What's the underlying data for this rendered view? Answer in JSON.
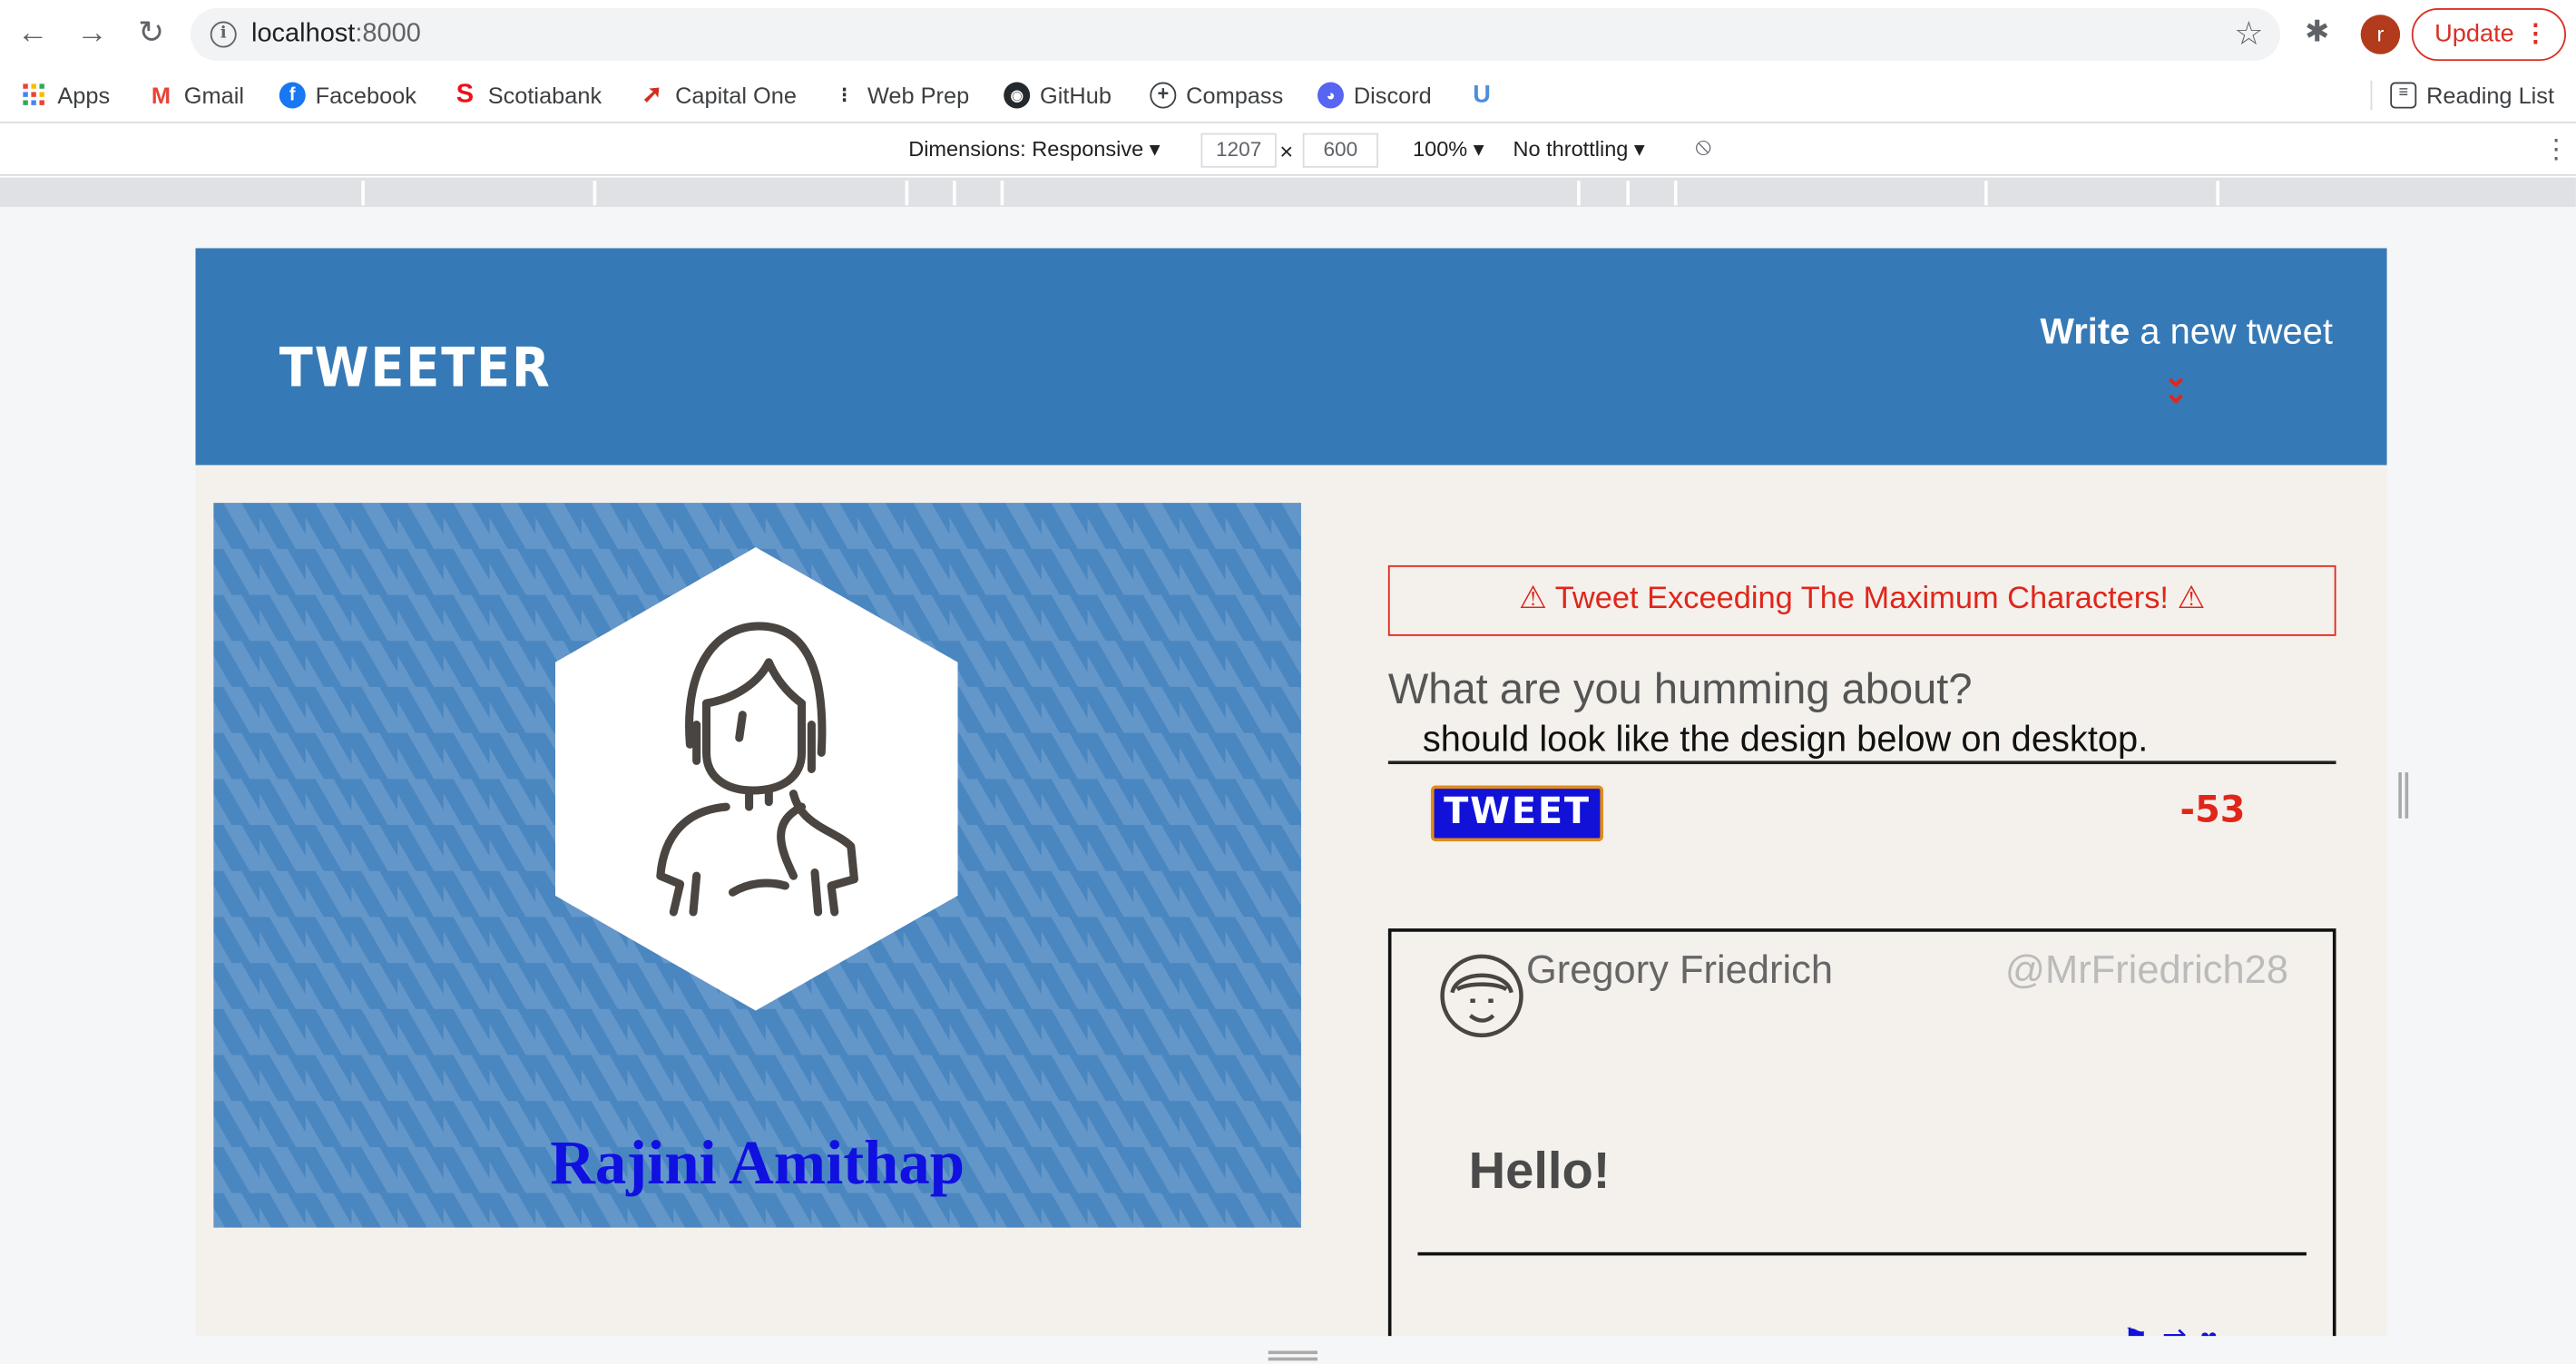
{
  "browser": {
    "url_host": "localhost",
    "url_port": ":8000",
    "profile_initial": "r",
    "update_label": "Update",
    "bookmarks": [
      {
        "label": "Apps",
        "icon": "apps-grid-icon",
        "color": "#ea4335"
      },
      {
        "label": "Gmail",
        "icon": "gmail-icon",
        "color": "#ea4335"
      },
      {
        "label": "Facebook",
        "icon": "facebook-icon",
        "color": "#1877f2"
      },
      {
        "label": "Scotiabank",
        "icon": "scotiabank-icon",
        "color": "#ec111a"
      },
      {
        "label": "Capital One",
        "icon": "capital-one-icon",
        "color": "#d22e1e"
      },
      {
        "label": "Web Prep",
        "icon": "web-prep-icon",
        "color": "#333333"
      },
      {
        "label": "GitHub",
        "icon": "github-icon",
        "color": "#24292e"
      },
      {
        "label": "Compass",
        "icon": "compass-icon",
        "color": "#3c4043"
      },
      {
        "label": "Discord",
        "icon": "discord-icon",
        "color": "#5865f2"
      }
    ],
    "reading_list_label": "Reading List"
  },
  "devtools": {
    "dimensions_label": "Dimensions: Responsive",
    "width": "1207",
    "times": "×",
    "height": "600",
    "zoom": "100%",
    "throttling": "No throttling"
  },
  "app": {
    "logo": "TWEETER",
    "write_bold": "Write",
    "write_rest": " a new tweet",
    "profile_name": "Rajini Amithap",
    "error_message": "Tweet Exceeding The Maximum Characters!",
    "compose_prompt": "What are you humming about?",
    "compose_text": "should look like the design below on desktop.",
    "tweet_button": "TWEET",
    "char_counter": "-53",
    "tweet": {
      "author": "Gregory Friedrich",
      "handle": "@MrFriedrich28",
      "content": "Hello!"
    },
    "colors": {
      "header": "#357ab6",
      "accent": "#e0261b",
      "button": "#1111d8"
    }
  }
}
